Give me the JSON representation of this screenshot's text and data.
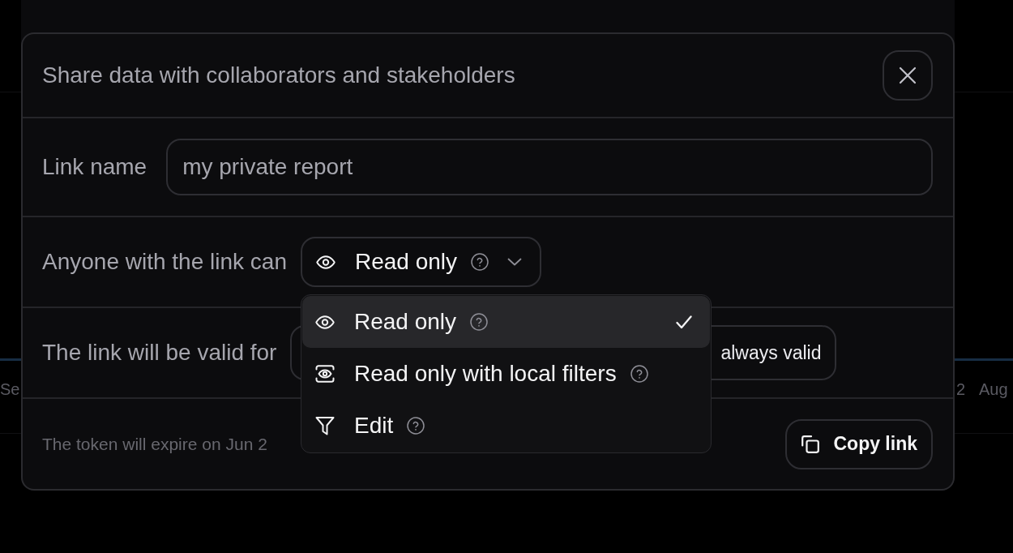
{
  "background": {
    "axis_labels": [
      "Se",
      "2",
      "Aug"
    ]
  },
  "dialog": {
    "title": "Share data with collaborators and stakeholders"
  },
  "link_name": {
    "label": "Link name",
    "value": "my private report"
  },
  "permission": {
    "label": "Anyone with the link can",
    "value": "Read only",
    "expanded": true,
    "options": [
      {
        "label": "Read only",
        "kind": "view",
        "selected": true
      },
      {
        "label": "Read only with local filters",
        "kind": "view-filtered",
        "selected": false
      },
      {
        "label": "Edit",
        "kind": "edit",
        "selected": false
      }
    ]
  },
  "validity": {
    "label": "The link will be valid for",
    "value": "always valid"
  },
  "footer": {
    "note": "The token will expire on Jun 2",
    "button": "Copy link"
  }
}
